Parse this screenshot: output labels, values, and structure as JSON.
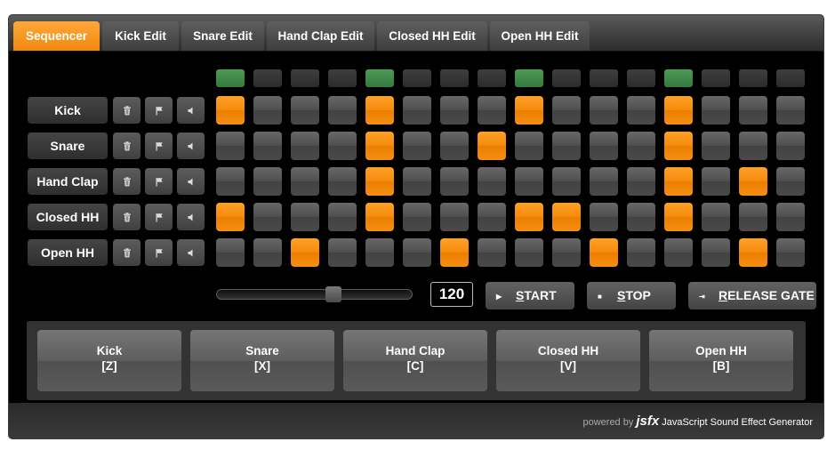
{
  "tabs": [
    {
      "label": "Sequencer",
      "active": true
    },
    {
      "label": "Kick Edit",
      "active": false
    },
    {
      "label": "Snare Edit",
      "active": false
    },
    {
      "label": "Hand Clap Edit",
      "active": false
    },
    {
      "label": "Closed HH Edit",
      "active": false
    },
    {
      "label": "Open HH Edit",
      "active": false
    }
  ],
  "step_indicators": [
    1,
    0,
    0,
    0,
    1,
    0,
    0,
    0,
    1,
    0,
    0,
    0,
    1,
    0,
    0,
    0
  ],
  "tracks": [
    {
      "label": "Kick",
      "steps": [
        1,
        0,
        0,
        0,
        1,
        0,
        0,
        0,
        1,
        0,
        0,
        0,
        1,
        0,
        0,
        0
      ]
    },
    {
      "label": "Snare",
      "steps": [
        0,
        0,
        0,
        0,
        1,
        0,
        0,
        1,
        0,
        0,
        0,
        0,
        1,
        0,
        0,
        0
      ]
    },
    {
      "label": "Hand Clap",
      "steps": [
        0,
        0,
        0,
        0,
        1,
        0,
        0,
        0,
        0,
        0,
        0,
        0,
        1,
        0,
        1,
        0
      ]
    },
    {
      "label": "Closed HH",
      "steps": [
        1,
        0,
        0,
        0,
        1,
        0,
        0,
        0,
        1,
        1,
        0,
        0,
        1,
        0,
        0,
        0
      ]
    },
    {
      "label": "Open HH",
      "steps": [
        0,
        0,
        1,
        0,
        0,
        0,
        1,
        0,
        0,
        0,
        1,
        0,
        0,
        0,
        1,
        0
      ]
    }
  ],
  "row_icons": [
    "trash-icon",
    "flag-icon",
    "speaker-icon"
  ],
  "tempo": {
    "bpm": "120"
  },
  "controls": {
    "start": {
      "first": "S",
      "rest": "TART"
    },
    "stop": {
      "first": "S",
      "rest": "TOP"
    },
    "release": {
      "first": "R",
      "rest": "ELEASE GATE"
    }
  },
  "pads": [
    {
      "name": "Kick",
      "key": "[Z]"
    },
    {
      "name": "Snare",
      "key": "[X]"
    },
    {
      "name": "Hand Clap",
      "key": "[C]"
    },
    {
      "name": "Closed HH",
      "key": "[V]"
    },
    {
      "name": "Open HH",
      "key": "[B]"
    }
  ],
  "footer": {
    "powered": "powered by",
    "brand": "jsfx",
    "tagline": "JavaScript Sound Effect Generator"
  },
  "colors": {
    "accent": "#f58a08",
    "indicator_on": "#3f8a4a",
    "step_off": "#4a4a4a"
  }
}
